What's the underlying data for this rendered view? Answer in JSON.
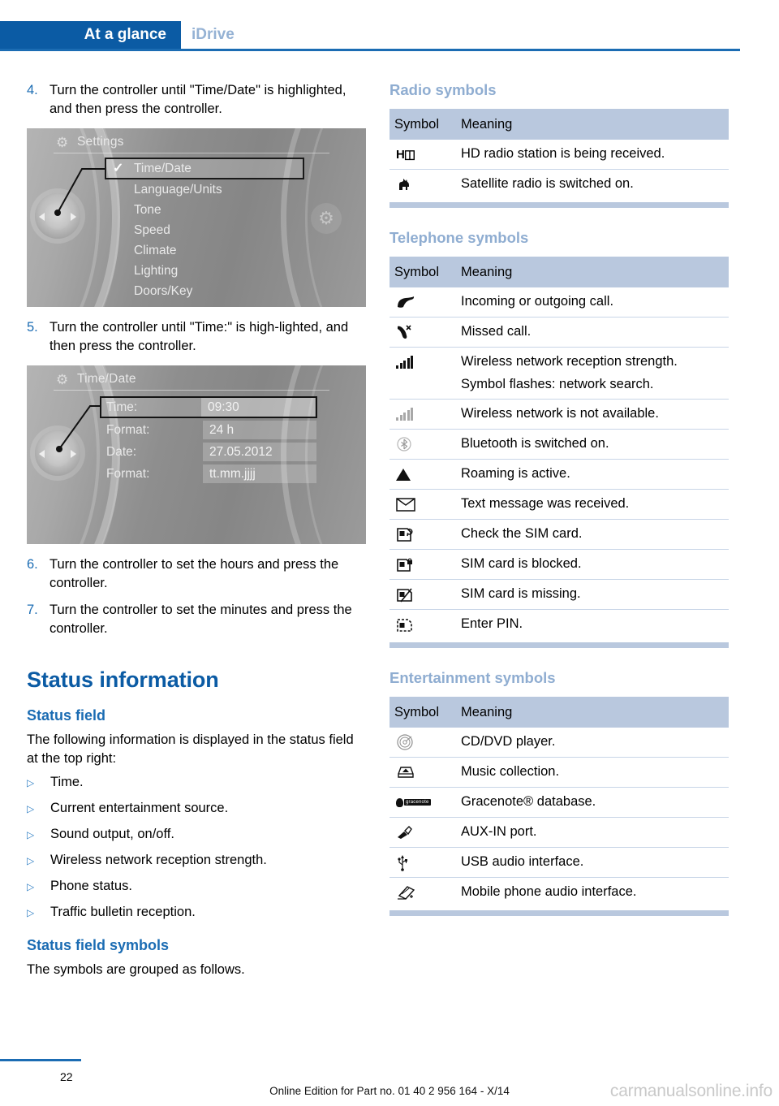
{
  "header": {
    "active_tab": "At a glance",
    "inactive_tab": "iDrive"
  },
  "left_column": {
    "steps": [
      {
        "num": "4.",
        "text": "Turn the controller until \"Time/Date\" is highlighted, and then press the controller."
      },
      {
        "num": "5.",
        "text": "Turn the controller until \"Time:\" is high-lighted, and then press the controller."
      },
      {
        "num": "6.",
        "text": "Turn the controller to set the hours and press the controller."
      },
      {
        "num": "7.",
        "text": "Turn the controller to set the minutes and press the controller."
      }
    ],
    "idrive_settings": {
      "title": "Settings",
      "title_icon": "gear-icon",
      "items": [
        {
          "label": "Time/Date",
          "selected": true,
          "check": "✓"
        },
        {
          "label": "Language/Units",
          "selected": false
        },
        {
          "label": "Tone",
          "selected": false
        },
        {
          "label": "Speed",
          "selected": false
        },
        {
          "label": "Climate",
          "selected": false
        },
        {
          "label": "Lighting",
          "selected": false
        },
        {
          "label": "Doors/Key",
          "selected": false
        }
      ]
    },
    "idrive_timedate": {
      "title": "Time/Date",
      "title_icon": "gear-icon",
      "rows": [
        {
          "label": "Time:",
          "value": "09:30",
          "selected": true
        },
        {
          "label": "Format:",
          "value": "24 h",
          "selected": false
        },
        {
          "label": "Date:",
          "value": "27.05.2012",
          "selected": false
        },
        {
          "label": "Format:",
          "value": "tt.mm.jjjj",
          "selected": false
        }
      ]
    },
    "status_information_heading": "Status information",
    "status_field_heading": "Status field",
    "status_field_intro": "The following information is displayed in the status field at the top right:",
    "status_field_bullets": [
      "Time.",
      "Current entertainment source.",
      "Sound output, on/off.",
      "Wireless network reception strength.",
      "Phone status.",
      "Traffic bulletin reception."
    ],
    "status_field_symbols_heading": "Status field symbols",
    "status_field_symbols_intro": "The symbols are grouped as follows."
  },
  "right_column": {
    "tables": [
      {
        "heading": "Radio symbols",
        "columns": [
          "Symbol",
          "Meaning"
        ],
        "rows": [
          {
            "icon": "hd-radio-icon",
            "icon_glyph": "HD",
            "meaning": "HD radio station is being received."
          },
          {
            "icon": "satellite-radio-dog-icon",
            "icon_glyph": "🐕",
            "meaning": "Satellite radio is switched on."
          }
        ]
      },
      {
        "heading": "Telephone symbols",
        "columns": [
          "Symbol",
          "Meaning"
        ],
        "rows": [
          {
            "icon": "phone-handset-icon",
            "icon_glyph": "✆",
            "meaning": "Incoming or outgoing call."
          },
          {
            "icon": "missed-call-icon",
            "icon_glyph": "✆",
            "meaning": "Missed call."
          },
          {
            "icon": "signal-bars-icon",
            "icon_glyph": "",
            "meaning": "Wireless network reception strength.",
            "sub": "Symbol flashes: network search."
          },
          {
            "icon": "signal-bars-grey-icon",
            "icon_glyph": "",
            "meaning": "Wireless network is not available."
          },
          {
            "icon": "bluetooth-icon",
            "icon_glyph": "",
            "meaning": "Bluetooth is switched on."
          },
          {
            "icon": "roaming-triangle-icon",
            "icon_glyph": "▲",
            "meaning": "Roaming is active."
          },
          {
            "icon": "envelope-icon",
            "icon_glyph": "✉",
            "meaning": "Text message was received."
          },
          {
            "icon": "sim-check-icon",
            "icon_glyph": "",
            "meaning": "Check the SIM card."
          },
          {
            "icon": "sim-blocked-icon",
            "icon_glyph": "",
            "meaning": "SIM card is blocked."
          },
          {
            "icon": "sim-missing-icon",
            "icon_glyph": "",
            "meaning": "SIM card is missing."
          },
          {
            "icon": "sim-enter-pin-icon",
            "icon_glyph": "",
            "meaning": "Enter PIN."
          }
        ]
      },
      {
        "heading": "Entertainment symbols",
        "columns": [
          "Symbol",
          "Meaning"
        ],
        "rows": [
          {
            "icon": "cd-dvd-disc-icon",
            "icon_glyph": "◎",
            "meaning": "CD/DVD player."
          },
          {
            "icon": "music-collection-icon",
            "icon_glyph": "",
            "meaning": "Music collection."
          },
          {
            "icon": "gracenote-icon",
            "icon_glyph": "gracenote",
            "meaning": "Gracenote® database."
          },
          {
            "icon": "aux-in-plug-icon",
            "icon_glyph": "",
            "meaning": "AUX-IN port."
          },
          {
            "icon": "usb-icon",
            "icon_glyph": "",
            "meaning": "USB audio interface."
          },
          {
            "icon": "mobile-phone-audio-icon",
            "icon_glyph": "",
            "meaning": "Mobile phone audio interface."
          }
        ]
      }
    ]
  },
  "footer": {
    "page_number": "22",
    "edition_note": "Online Edition for Part no. 01 40 2 956 164 - X/14",
    "watermark": "carmanualsonline.info"
  },
  "colors": {
    "brand_blue": "#0b5ba4",
    "rule_blue": "#1b6cb3",
    "table_header_bg": "#b9c8de",
    "table_heading_text": "#8fadd1",
    "inactive_tab": "#95b2d4"
  }
}
